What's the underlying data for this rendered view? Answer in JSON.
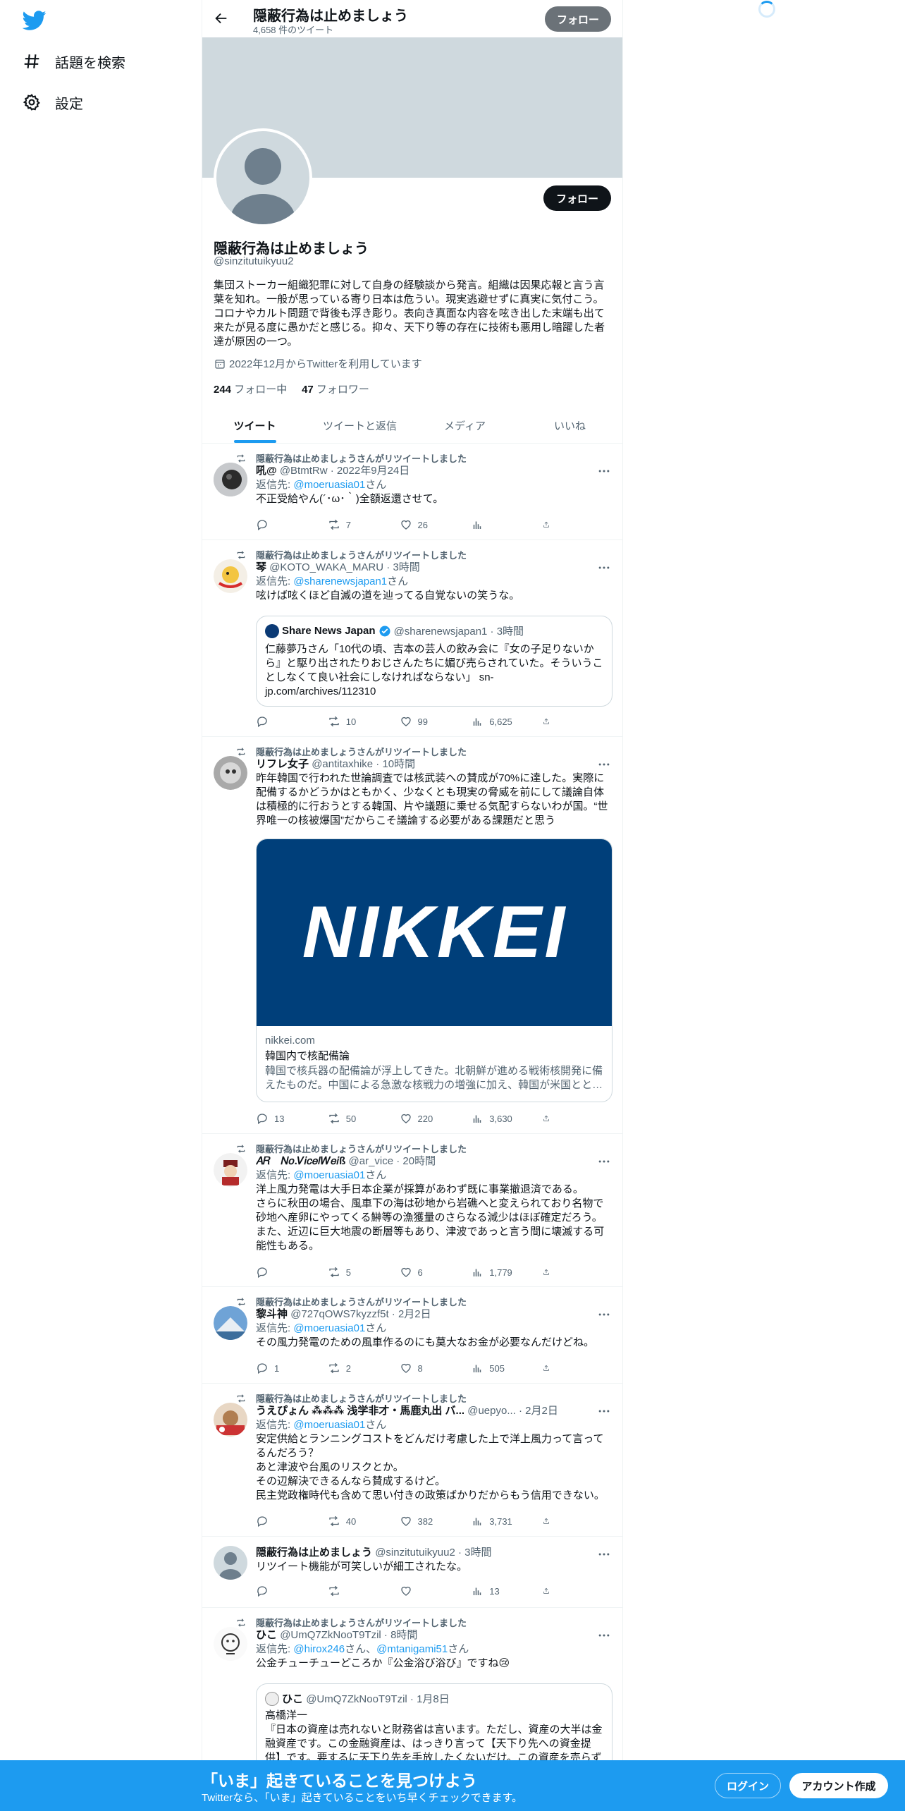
{
  "nav": {
    "items": [
      {
        "label": "話題を検索",
        "icon": "hashtag-icon"
      },
      {
        "label": "設定",
        "icon": "gear-icon"
      }
    ]
  },
  "header": {
    "title": "隠蔽行為は止めましょう",
    "tweet_count": "4,658 件のツイート",
    "follow_label": "フォロー"
  },
  "profile": {
    "name": "隠蔽行為は止めましょう",
    "handle": "@sinzitutuikyuu2",
    "bio": "集団ストーカー組織犯罪に対して自身の経験談から発言。組織は因果応報と言う言葉を知れ。一般が思っている寄り日本は危うい。現実逃避せずに真実に気付こう。コロナやカルト問題で背後も浮き彫り。表向き真面な内容を呟き出した末端も出て来たが見る度に愚かだと感じる。抑々、天下り等の存在に技術も悪用し暗躍した者達が原因の一つ。",
    "joined": "2022年12月からTwitterを利用しています",
    "following_count": "244",
    "following_label": "フォロー中",
    "followers_count": "47",
    "followers_label": "フォロワー",
    "follow_label": "フォロー"
  },
  "tabs": [
    {
      "label": "ツイート",
      "active": true
    },
    {
      "label": "ツイートと返信",
      "active": false
    },
    {
      "label": "メディア",
      "active": false
    },
    {
      "label": "いいね",
      "active": false
    }
  ],
  "tweets": [
    {
      "retweet_label": "隠蔽行為は止めましょうさんがリツイートしました",
      "name": "吼@",
      "meta": "@BtmtRw · 2022年9月24日",
      "reply_prefix": "返信先: ",
      "reply_to": "@moeruasia01",
      "reply_suffix": "さん",
      "text": "不正受給やん(´･ω･｀)全額返還させて。",
      "replies": "",
      "retweets": "7",
      "likes": "26",
      "views": ""
    },
    {
      "retweet_label": "隠蔽行為は止めましょうさんがリツイートしました",
      "name": "琴",
      "meta": "@KOTO_WAKA_MARU · 3時間",
      "reply_prefix": "返信先: ",
      "reply_to": "@sharenewsjapan1",
      "reply_suffix": "さん",
      "text": "呟けば呟くほど自滅の道を辿ってる自覚ないの笑うな。",
      "quote": {
        "name": "Share News Japan",
        "meta": "@sharenewsjapan1 · 3時間",
        "text": "仁藤夢乃さん「10代の頃、吉本の芸人の飲み会に『女の子足りないから』と駆り出されたりおじさんたちに媚び売らされていた。そういうことしなくて良い社会にしなければならない」 sn-jp.com/archives/112310"
      },
      "replies": "",
      "retweets": "10",
      "likes": "99",
      "views": "6,625"
    },
    {
      "retweet_label": "隠蔽行為は止めましょうさんがリツイートしました",
      "name": "リフレ女子",
      "meta": "@antitaxhike · 10時間",
      "text": "昨年韓国で行われた世論調査では核武装への賛成が70%に達した。実際に配備するかどうかはともかく、少なくとも現実の脅威を前にして議論自体は積極的に行おうとする韓国、片や議題に乗せる気配すらないわが国。“世界唯一の核被爆国”だからこそ議論する必要がある課題だと思う",
      "card": {
        "logo": "NIKKEI",
        "domain": "nikkei.com",
        "title": "韓国内で核配備論",
        "desc": "韓国で核兵器の配備論が浮上してきた。北朝鮮が進める戦術核開発に備えたものだ。中国による急激な核戦力の増強に加え、韓国が米国とと…"
      },
      "replies": "13",
      "retweets": "50",
      "likes": "220",
      "views": "3,630"
    },
    {
      "retweet_label": "隠蔽行為は止めましょうさんがリツイートしました",
      "name": "𝐴𝑅　𝑁𝑜.𝑉𝑖𝑐𝑒/𝑊𝑒𝑖ß",
      "meta": "@ar_vice · 20時間",
      "reply_prefix": "返信先: ",
      "reply_to": "@moeruasia01",
      "reply_suffix": "さん",
      "text": "洋上風力発電は大手日本企業が採算があわず既に事業撤退済である。\nさらに秋田の場合、風車下の海は砂地から岩礁へと変えられており名物で砂地へ産卵にやってくる鰰等の漁獲量のさらなる減少はほぼ確定だろう。\nまた、近辺に巨大地震の断層等もあり、津波であっと言う間に壊滅する可能性もある。",
      "replies": "",
      "retweets": "5",
      "likes": "6",
      "views": "1,779"
    },
    {
      "retweet_label": "隠蔽行為は止めましょうさんがリツイートしました",
      "name": "黎斗神",
      "meta": "@727qOWS7kyzzf5t · 2月2日",
      "reply_prefix": "返信先: ",
      "reply_to": "@moeruasia01",
      "reply_suffix": "さん",
      "text": "その風力発電のための風車作るのにも莫大なお金が必要なんだけどね。",
      "replies": "1",
      "retweets": "2",
      "likes": "8",
      "views": "505"
    },
    {
      "retweet_label": "隠蔽行為は止めましょうさんがリツイートしました",
      "name": "うえぴょん ⁂⁂⁂ 浅学非才・馬鹿丸出 バ...",
      "meta": "@uepyo... · 2月2日",
      "reply_prefix": "返信先: ",
      "reply_to": "@moeruasia01",
      "reply_suffix": "さん",
      "text": "安定供給とランニングコストをどんだけ考慮した上で洋上風力って言ってるんだろう？\nあと津波や台風のリスクとか。\nその辺解決できるんなら賛成するけど。\n民主党政権時代も含めて思い付きの政策ばかりだからもう信用できない。",
      "replies": "",
      "retweets": "40",
      "likes": "382",
      "views": "3,731"
    },
    {
      "name": "隠蔽行為は止めましょう",
      "meta": "@sinzitutuikyuu2 · 3時間",
      "text": "リツイート機能が可笑しいが細工されたな。",
      "replies": "",
      "retweets": "",
      "likes": "",
      "views": "13"
    },
    {
      "retweet_label": "隠蔽行為は止めましょうさんがリツイートしました",
      "name": "ひこ",
      "meta": "@UmQ7ZkNooT9Tzil · 8時間",
      "reply_prefix": "返信先: ",
      "reply_to": "@hirox246",
      "reply_mid": "さん、",
      "reply_to2": "@mtanigami51",
      "reply_suffix": "さん",
      "text": "公金チューチューどころか『公金浴び浴び』ですね😢",
      "quote": {
        "name": "ひこ",
        "meta": "@UmQ7ZkNooT9Tzil · 1月8日",
        "subname": "高橋洋一",
        "text": "『日本の資産は売れないと財務省は言います。ただし、資産の大半は金融資産です。この金融資産は、はっきり言って【天下り先への資金提供】です。要するに天下り先を手放したくないだけ。この資産を売らず"
      }
    }
  ],
  "bottom_bar": {
    "title": "「いま」起きていることを見つけよう",
    "subtitle": "Twitterなら、「いま」起きていることをいち早くチェックできます。",
    "login_label": "ログイン",
    "signup_label": "アカウント作成"
  },
  "colors": {
    "accent": "#1d9bf0",
    "text": "#0f1419",
    "secondary": "#536471",
    "banner": "#cfd9de",
    "nikkei": "#003f7a"
  }
}
